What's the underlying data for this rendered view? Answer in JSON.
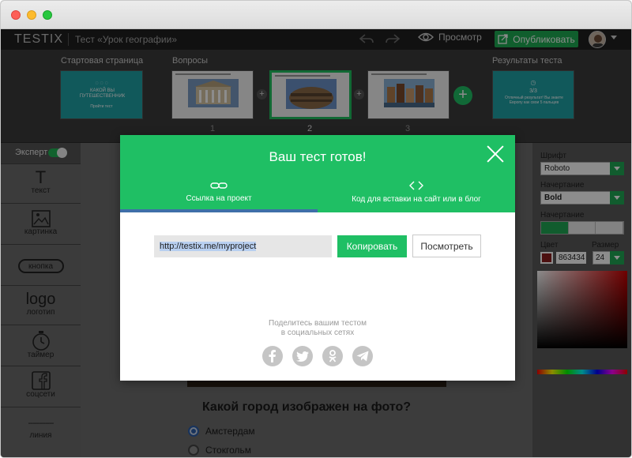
{
  "topbar": {
    "logo": "TESTIX",
    "doc_title": "Тест «Урок географии»",
    "preview_label": "Просмотр",
    "publish_label": "Опубликовать"
  },
  "slides": {
    "start_label": "Стартовая страница",
    "questions_label": "Вопросы",
    "results_label": "Результаты теста",
    "start_thumb_text": "КАКОЙ ВЫ ПУТЕШЕСТВЕННИК",
    "start_thumb_btn": "Пройти тест",
    "question_numbers": [
      "1",
      "2",
      "3"
    ],
    "results_thumb_score": "3/3",
    "results_thumb_text": "Отличный результат! Вы знаете Европу как свои 5 пальцев"
  },
  "tools": {
    "expert_label": "Эксперт",
    "items": [
      {
        "icon": "T",
        "label": "текст"
      },
      {
        "icon": "image",
        "label": "картинка"
      },
      {
        "icon": "кнопка",
        "label": ""
      },
      {
        "icon": "logo",
        "label": "логотип"
      },
      {
        "icon": "timer",
        "label": "таймер"
      },
      {
        "icon": "facebook",
        "label": "соцсети"
      },
      {
        "icon": "------------",
        "label": "линия"
      }
    ]
  },
  "canvas": {
    "question": "Какой город изображен на фото?",
    "options": [
      "Амстердам",
      "Стокгольм"
    ]
  },
  "props": {
    "font_label": "Шрифт",
    "font_value": "Roboto",
    "weight_label": "Начертание",
    "weight_value": "Bold",
    "align_label": "Начертание",
    "color_label": "Цвет",
    "color_value": "863434",
    "size_label": "Размер",
    "size_value": "24"
  },
  "modal": {
    "title": "Ваш тест готов!",
    "tab_link": "Ссылка на проект",
    "tab_embed": "Код для вставки на сайт или в блог",
    "url": "http://testix.me/myproject",
    "copy_label": "Копировать",
    "view_label": "Посмотреть",
    "share_line1": "Поделитесь вашим тестом",
    "share_line2": "в социальных сетях",
    "social": [
      "f",
      "t",
      "ok",
      "tg"
    ]
  }
}
